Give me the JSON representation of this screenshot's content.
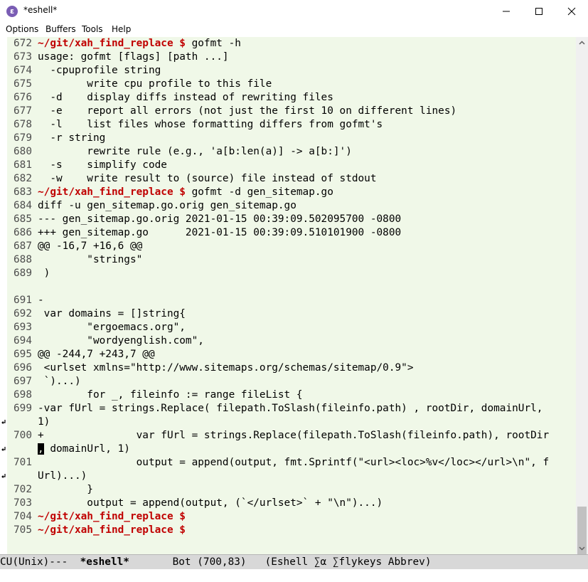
{
  "window": {
    "title": "*eshell*",
    "app_icon_glyph": "ε"
  },
  "menu": [
    "Options",
    "Buffers",
    "Tools",
    "Help"
  ],
  "colors": {
    "buffer_bg": "#f0f8e8",
    "prompt": "#c00000",
    "line_number": "#4d4d4d",
    "modeline_bg": "#d8d8d8"
  },
  "lines": [
    {
      "n": "672",
      "prompt": "~/git/xah_find_replace $",
      "text": " gofmt -h"
    },
    {
      "n": "673",
      "text": "usage: gofmt [flags] [path ...]"
    },
    {
      "n": "674",
      "text": "  -cpuprofile string"
    },
    {
      "n": "675",
      "text": "        write cpu profile to this file"
    },
    {
      "n": "676",
      "text": "  -d    display diffs instead of rewriting files"
    },
    {
      "n": "677",
      "text": "  -e    report all errors (not just the first 10 on different lines)"
    },
    {
      "n": "678",
      "text": "  -l    list files whose formatting differs from gofmt's"
    },
    {
      "n": "679",
      "text": "  -r string"
    },
    {
      "n": "680",
      "text": "        rewrite rule (e.g., 'a[b:len(a)] -> a[b:]')"
    },
    {
      "n": "681",
      "text": "  -s    simplify code"
    },
    {
      "n": "682",
      "text": "  -w    write result to (source) file instead of stdout"
    },
    {
      "n": "683",
      "prompt": "~/git/xah_find_replace $",
      "text": " gofmt -d gen_sitemap.go"
    },
    {
      "n": "684",
      "text": "diff -u gen_sitemap.go.orig gen_sitemap.go"
    },
    {
      "n": "685",
      "text": "--- gen_sitemap.go.orig 2021-01-15 00:39:09.502095700 -0800"
    },
    {
      "n": "686",
      "text": "+++ gen_sitemap.go      2021-01-15 00:39:09.510101900 -0800"
    },
    {
      "n": "687",
      "text": "@@ -16,7 +16,6 @@"
    },
    {
      "n": "688",
      "text": "        \"strings\""
    },
    {
      "n": "689",
      "text": " )"
    },
    {
      "n": "",
      "text": ""
    },
    {
      "n": "691",
      "text": "-"
    },
    {
      "n": "692",
      "text": " var domains = []string{"
    },
    {
      "n": "693",
      "text": "        \"ergoemacs.org\","
    },
    {
      "n": "694",
      "text": "        \"wordyenglish.com\","
    },
    {
      "n": "695",
      "text": "@@ -244,7 +243,7 @@"
    },
    {
      "n": "696",
      "text": " <urlset xmlns=\"http://www.sitemaps.org/schemas/sitemap/0.9\">"
    },
    {
      "n": "697",
      "text": " `)...)"
    },
    {
      "n": "698",
      "text": "        for _, fileinfo := range fileList {"
    },
    {
      "n": "699",
      "text": "-var fUrl = strings.Replace( filepath.ToSlash(fileinfo.path) , rootDir, domainUrl, ",
      "wrap": true
    },
    {
      "n": "",
      "text": "1)",
      "wrapped": true
    },
    {
      "n": "700",
      "text": "+               var fUrl = strings.Replace(filepath.ToSlash(fileinfo.path), rootDir",
      "wrap": true
    },
    {
      "n": "",
      "cursor": ",",
      "text": " domainUrl, 1)",
      "wrapped": true
    },
    {
      "n": "701",
      "text": "                output = append(output, fmt.Sprintf(\"<url><loc>%v</loc></url>\\n\", f",
      "wrap": true
    },
    {
      "n": "",
      "text": "Url)...)",
      "wrapped": true
    },
    {
      "n": "702",
      "text": "        }"
    },
    {
      "n": "703",
      "text": "        output = append(output, (`</urlset>` + \"\\n\")...)"
    },
    {
      "n": "704",
      "prompt": "~/git/xah_find_replace $",
      "text": ""
    },
    {
      "n": "705",
      "prompt": "~/git/xah_find_replace $",
      "text": ""
    }
  ],
  "modeline": {
    "left": "CU(Unix)---  ",
    "buffer": "*eshell*",
    "position": "       Bot (700,83)   ",
    "modes": "(Eshell ∑α ∑flykeys Abbrev)"
  }
}
